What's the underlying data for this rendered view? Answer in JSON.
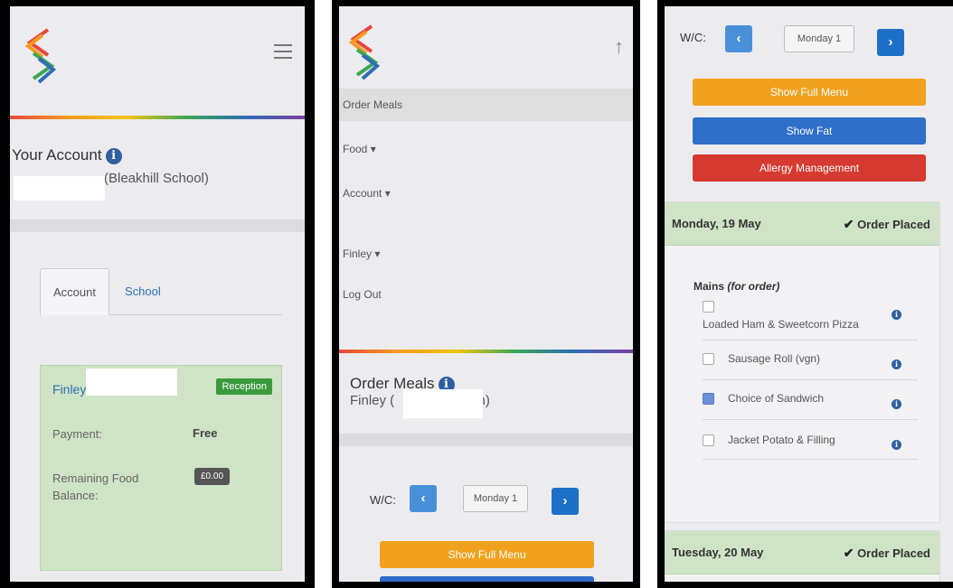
{
  "screens": {
    "account": {
      "title": "Your Account",
      "school_subtitle": "(Bleakhill School)",
      "tabs": [
        "Account",
        "School"
      ],
      "child": {
        "name": "Finley",
        "class_badge": "Reception",
        "payment_label": "Payment:",
        "payment_value": "Free",
        "balance_label": "Remaining Food Balance:",
        "balance_value": "£0.00"
      }
    },
    "menu": {
      "items": [
        "Order Meals",
        "Food",
        "Account",
        "Finley",
        "Log Out"
      ],
      "section_title": "Order Meals",
      "child_line_start": "Finley (",
      "child_line_end": "on)",
      "wc_label": "W/C:",
      "week_value": "Monday 1",
      "show_full_menu": "Show Full Menu"
    },
    "order": {
      "wc_label": "W/C:",
      "week_value": "Monday 1",
      "buttons": {
        "show_full_menu": "Show Full Menu",
        "show_fat": "Show Fat",
        "allergy": "Allergy Management"
      },
      "days": [
        {
          "date": "Monday, 19 May",
          "status": "Order Placed"
        },
        {
          "date": "Tuesday, 20 May",
          "status": "Order Placed"
        }
      ],
      "mains_label": "Mains",
      "mains_note": "(for order)",
      "meals": [
        {
          "name": "Loaded Ham & Sweetcorn Pizza",
          "checked": false
        },
        {
          "name": "Sausage Roll (vgn)",
          "checked": false
        },
        {
          "name": "Choice of Sandwich",
          "checked": true
        },
        {
          "name": "Jacket Potato & Filling",
          "checked": false
        }
      ]
    }
  },
  "colors": {
    "brand_blue": "#2f6db5",
    "success_green": "#3a9a3e",
    "card_green": "#cfe3c6",
    "orange": "#f0a21e",
    "red": "#d73a31"
  }
}
